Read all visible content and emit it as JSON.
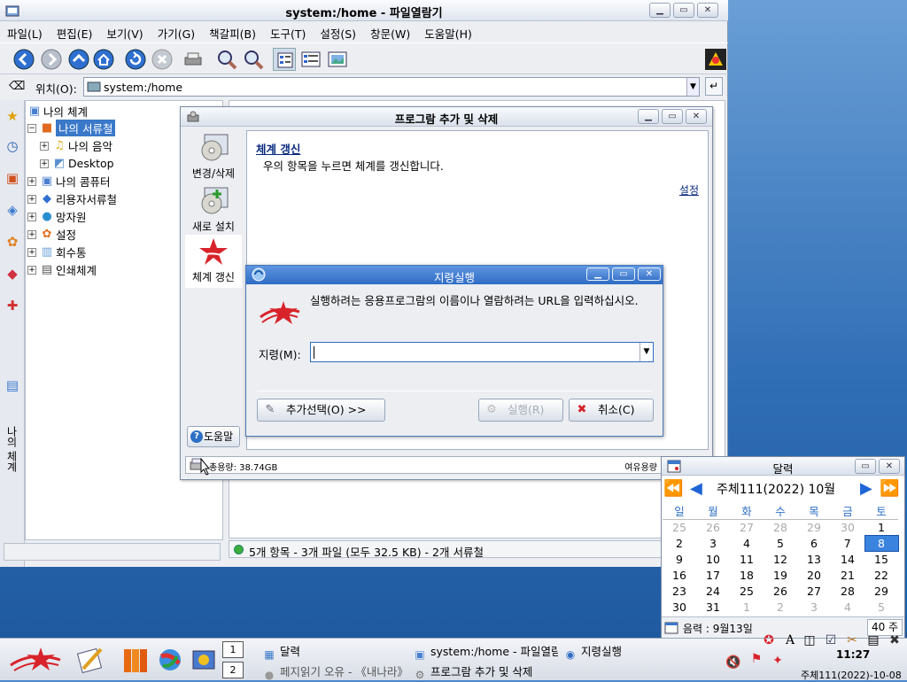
{
  "file_manager": {
    "title": "system:/home - 파일열람기",
    "menu": [
      "파일(L)",
      "편집(E)",
      "보기(V)",
      "가기(G)",
      "책갈피(B)",
      "도구(T)",
      "설정(S)",
      "창문(W)",
      "도움말(H)"
    ],
    "location_label": "위치(O):",
    "location_value": "system:/home",
    "side_tab_label": "나의 체계",
    "tree": [
      {
        "label": "나의 체계",
        "expander": "",
        "icon": "computer-icon"
      },
      {
        "label": "나의 서류철",
        "expander": "−",
        "icon": "folder-icon",
        "selected": true
      },
      {
        "label": "나의 음악",
        "expander": "+",
        "icon": "music-folder-icon"
      },
      {
        "label": "Desktop",
        "expander": "+",
        "icon": "desktop-folder-icon"
      },
      {
        "label": "나의 콤퓨터",
        "expander": "+",
        "icon": "computer-icon"
      },
      {
        "label": "리용자서류철",
        "expander": "+",
        "icon": "users-folder-icon"
      },
      {
        "label": "망자원",
        "expander": "+",
        "icon": "network-icon"
      },
      {
        "label": "설정",
        "expander": "+",
        "icon": "settings-icon"
      },
      {
        "label": "회수통",
        "expander": "+",
        "icon": "trash-icon"
      },
      {
        "label": "인쇄체계",
        "expander": "+",
        "icon": "printer-icon"
      }
    ],
    "status_text": "5개 항목 - 3개 파일 (모두 32.5 KB) - 2개 서류철"
  },
  "add_remove": {
    "title": "프로그람 추가 및 삭제",
    "modules": [
      {
        "label": "변경/삭제",
        "icon": "cd-change-icon"
      },
      {
        "label": "새로 설치",
        "icon": "cd-install-icon"
      },
      {
        "label": "체계 갱신",
        "icon": "red-star-icon",
        "active": true
      }
    ],
    "heading": "체계 갱신",
    "description": "우의 항목을 누르면 체계를 갱신합니다.",
    "settings_link": "설정",
    "help_button": "도움말",
    "disk_total": "총용량: 38.74GB",
    "disk_free": "여유용량"
  },
  "run_dialog": {
    "title": "지령실행",
    "message": "실행하려는 응용프로그람의 이름이나 열람하려는 URL을 입력하십시오.",
    "command_label": "지령(M):",
    "command_value": "",
    "more_options_button": "추가선택(O) >>",
    "run_button": "실행(R)",
    "cancel_button": "취소(C)"
  },
  "calendar": {
    "title": "달력",
    "month_label": "주체111(2022) 10월",
    "weekdays": [
      "일",
      "월",
      "화",
      "수",
      "목",
      "금",
      "토"
    ],
    "weeks": [
      [
        "25",
        "26",
        "27",
        "28",
        "29",
        "30",
        "1"
      ],
      [
        "2",
        "3",
        "4",
        "5",
        "6",
        "7",
        "8"
      ],
      [
        "9",
        "10",
        "11",
        "12",
        "13",
        "14",
        "15"
      ],
      [
        "16",
        "17",
        "18",
        "19",
        "20",
        "21",
        "22"
      ],
      [
        "23",
        "24",
        "25",
        "26",
        "27",
        "28",
        "29"
      ],
      [
        "30",
        "31",
        "1",
        "2",
        "3",
        "4",
        "5"
      ]
    ],
    "today": "8",
    "event_text": "음력 : 9월13일",
    "week_number": "40 주"
  },
  "taskbar": {
    "desktops": [
      "1",
      "2"
    ],
    "tasks": [
      {
        "label": "달력",
        "icon": "calendar-icon"
      },
      {
        "label": "system:/home - 파일열람기",
        "icon": "folder-icon"
      },
      {
        "label": "지령실행",
        "icon": "run-icon"
      },
      {
        "label": "페지읽기 오유 - 《내나라》",
        "icon": "browser-icon",
        "muted": true
      },
      {
        "label": "프로그람 추가 및 삭제",
        "icon": "installer-icon"
      }
    ],
    "clock_time": "11:27",
    "clock_date": "주체111(2022)-10-08"
  },
  "colors": {
    "selection": "#3a78c9",
    "run_titlebar": "#2f6cc4",
    "today_highlight": "#3a84e0",
    "star_red": "#d8232a"
  }
}
